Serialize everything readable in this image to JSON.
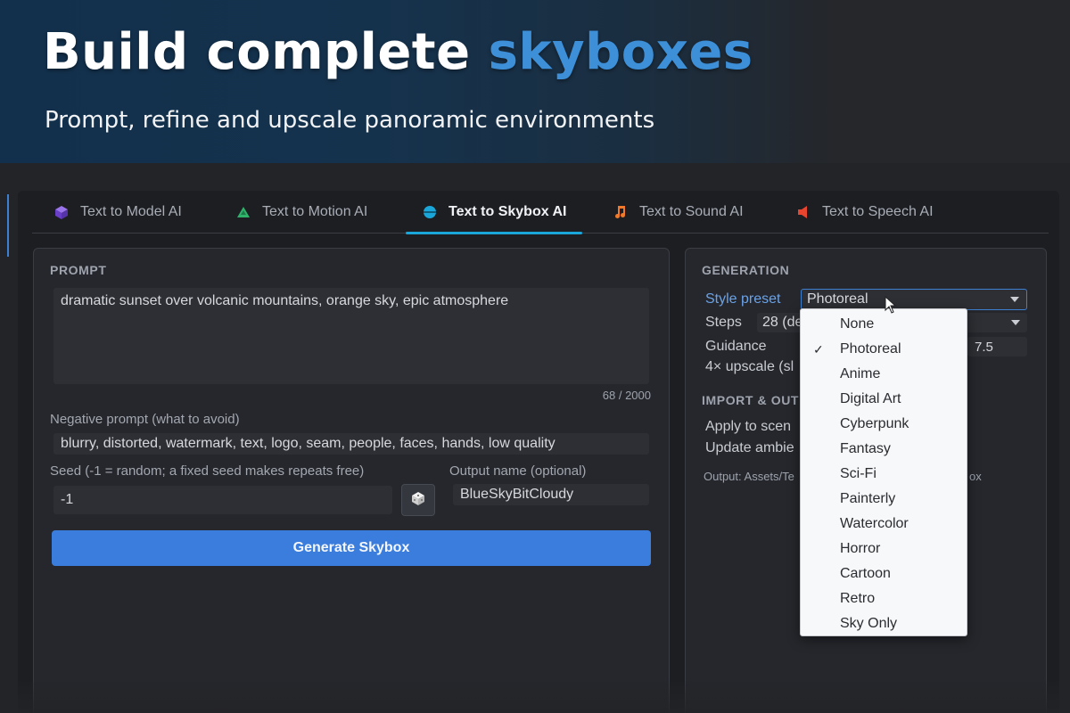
{
  "banner": {
    "title_main": "Build complete ",
    "title_accent": "skyboxes",
    "subtitle": "Prompt, refine and upscale panoramic environments"
  },
  "tabs": [
    {
      "label": "Text to Model AI",
      "icon": "cube-icon",
      "color": "#7b4fd6",
      "active": false
    },
    {
      "label": "Text to Motion AI",
      "icon": "motion-icon",
      "color": "#2fb36b",
      "active": false
    },
    {
      "label": "Text to Skybox AI",
      "icon": "sphere-icon",
      "color": "#1aa6d9",
      "active": true
    },
    {
      "label": "Text to Sound AI",
      "icon": "music-note-icon",
      "color": "#f07a2b",
      "active": false
    },
    {
      "label": "Text to Speech AI",
      "icon": "speaker-icon",
      "color": "#e8452f",
      "active": false
    }
  ],
  "prompt": {
    "section_title": "PROMPT",
    "value": "dramatic sunset over volcanic mountains, orange sky, epic atmosphere",
    "counter": "68 / 2000",
    "negative_label": "Negative prompt (what to avoid)",
    "negative_value": "blurry, distorted, watermark, text, logo, seam, people, faces, hands, low quality",
    "seed_label": "Seed (-1 = random; a fixed seed makes repeats free)",
    "seed_value": "-1",
    "output_label": "Output name (optional)",
    "output_value": "BlueSkyBitCloudy",
    "generate_label": "Generate Skybox"
  },
  "generation": {
    "section_title": "GENERATION",
    "style_label": "Style preset",
    "style_value": "Photoreal",
    "steps_label": "Steps",
    "steps_value": "28 (de",
    "guidance_label": "Guidance",
    "guidance_value": "7.5",
    "upscale_label": "4× upscale (sl",
    "import_title": "IMPORT & OUT",
    "apply_label": "Apply to scen",
    "update_label": "Update ambie",
    "output_path_left": "Output: Assets/Te",
    "output_path_right": "ox"
  },
  "style_dropdown": {
    "selected": "Photoreal",
    "options": [
      "None",
      "Photoreal",
      "Anime",
      "Digital Art",
      "Cyberpunk",
      "Fantasy",
      "Sci-Fi",
      "Painterly",
      "Watercolor",
      "Horror",
      "Cartoon",
      "Retro",
      "Sky Only"
    ]
  },
  "colors": {
    "accent_blue": "#3d8fd8",
    "generate_button": "#3b7ddd",
    "active_tab_underline": "#1aa6d9"
  }
}
